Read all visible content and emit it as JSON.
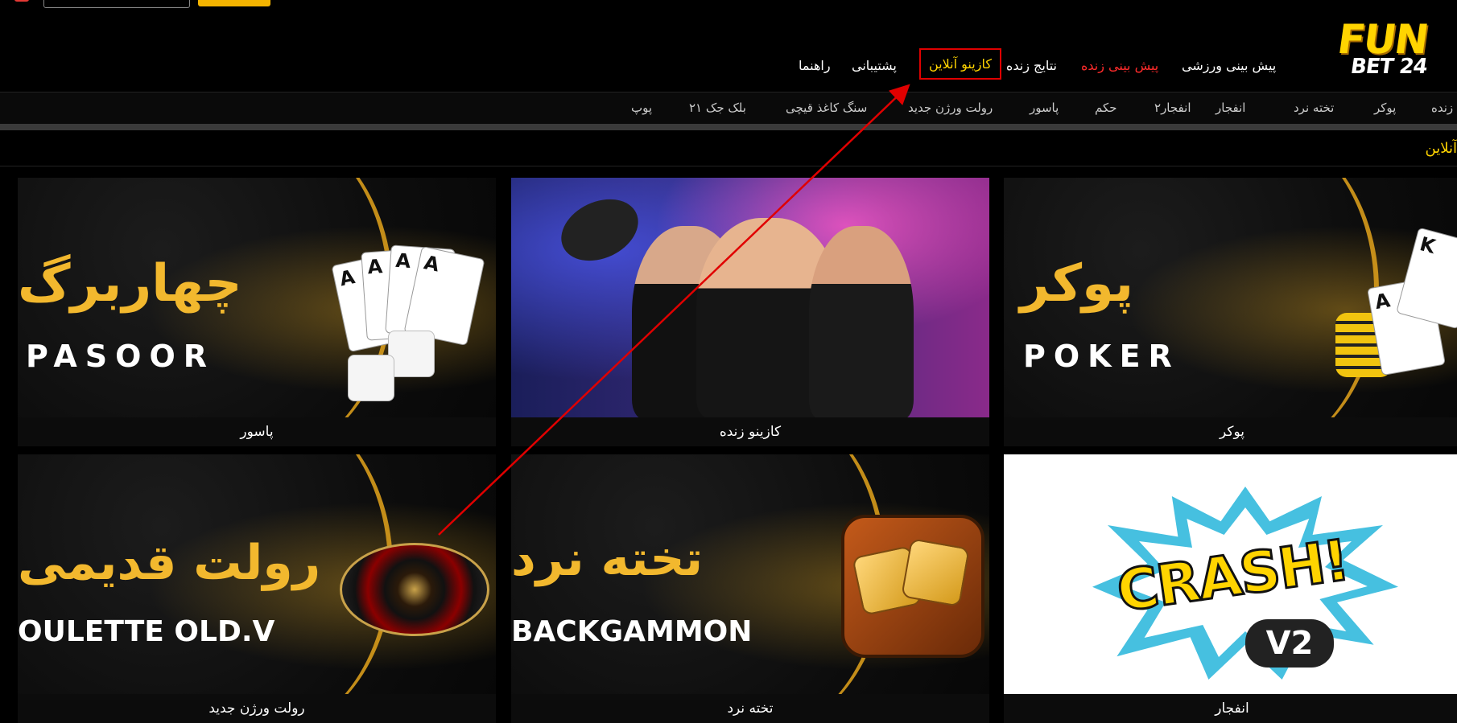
{
  "header": {
    "logo_fun": "FUN",
    "logo_bet": "BET 24"
  },
  "main_nav": [
    {
      "label": "پیش بینی ورزشی"
    },
    {
      "label": "پیش بینی زنده"
    },
    {
      "label": "نتایج زنده"
    },
    {
      "label": "کازینو آنلاین"
    },
    {
      "label": "پشتیبانی"
    },
    {
      "label": "راهنما"
    }
  ],
  "sub_nav": [
    {
      "label": "زنده"
    },
    {
      "label": "پوکر"
    },
    {
      "label": "تخته نرد"
    },
    {
      "label": "انفجار"
    },
    {
      "label": "انفجار۲"
    },
    {
      "label": "حکم"
    },
    {
      "label": "پاسور"
    },
    {
      "label": "رولت ورژن جدید"
    },
    {
      "label": "سنگ کاغذ قیچی"
    },
    {
      "label": "بلک جک ۲۱"
    },
    {
      "label": "پوپ"
    }
  ],
  "section_title": "آنلاین",
  "games": {
    "poker": {
      "caption": "پوکر",
      "banner_fa": "پوکر",
      "banner_en": "POKER"
    },
    "live_casino": {
      "caption": "کازینو زنده"
    },
    "pasoor": {
      "caption": "پاسور",
      "banner_fa": "چهاربرگ",
      "banner_en": "PASOOR"
    },
    "crash": {
      "caption": "انفجار",
      "banner_text": "CRASH!",
      "banner_badge": "V2"
    },
    "backgammon": {
      "caption": "تخته نرد",
      "banner_fa": "تخته نرد",
      "banner_en": "BACKGAMMON"
    },
    "roulette": {
      "caption": "رولت ورژن جدید",
      "banner_fa": "رولت قدیمی",
      "banner_en": "OULETTE OLD.V"
    }
  },
  "colors": {
    "accent": "#ffd400",
    "live": "#ff2b2b",
    "highlight_border": "#e00000",
    "arrow": "#e00000"
  }
}
